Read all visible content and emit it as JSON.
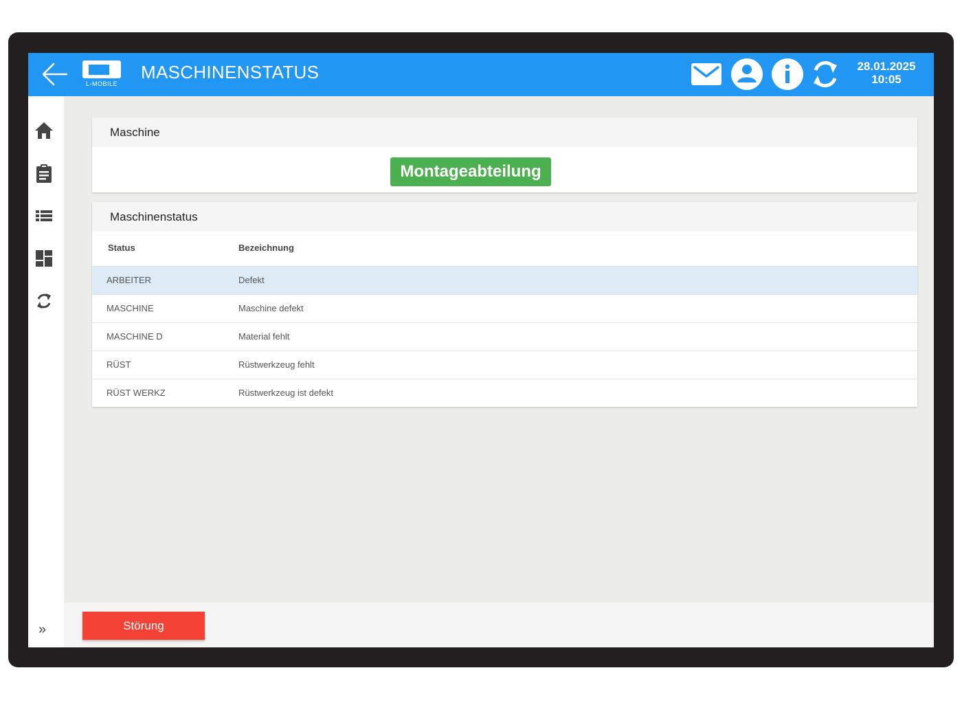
{
  "header": {
    "title": "MASCHINENSTATUS",
    "logo_text": "L-MOBILE",
    "date": "28.01.2025",
    "time": "10:05",
    "icons": [
      "back-arrow-icon",
      "mail-icon",
      "account-icon",
      "info-icon",
      "sync-icon"
    ]
  },
  "sidebar": {
    "items": [
      "home-icon",
      "clipboard-icon",
      "list-icon",
      "dashboard-icon",
      "sync-icon"
    ],
    "expand_label": "»"
  },
  "machine_card": {
    "header": "Maschine",
    "value": "Montageabteilung"
  },
  "status_card": {
    "header": "Maschinenstatus",
    "columns": [
      "Status",
      "Bezeichnung"
    ],
    "rows": [
      {
        "status": "ARBEITER",
        "bezeichnung": "Defekt",
        "selected": true
      },
      {
        "status": "MASCHINE",
        "bezeichnung": "Maschine defekt",
        "selected": false
      },
      {
        "status": "MASCHINE D",
        "bezeichnung": "Material fehlt",
        "selected": false
      },
      {
        "status": "RÜST",
        "bezeichnung": "Rüstwerkzeug fehlt",
        "selected": false
      },
      {
        "status": "RÜST WERKZ",
        "bezeichnung": "Rüstwerkzeug ist defekt",
        "selected": false
      }
    ]
  },
  "footer": {
    "button_label": "Störung"
  },
  "colors": {
    "primary": "#2196f3",
    "success": "#4caf50",
    "danger": "#f44336",
    "selected_row": "#dcebf5",
    "device_frame": "#231f20"
  }
}
